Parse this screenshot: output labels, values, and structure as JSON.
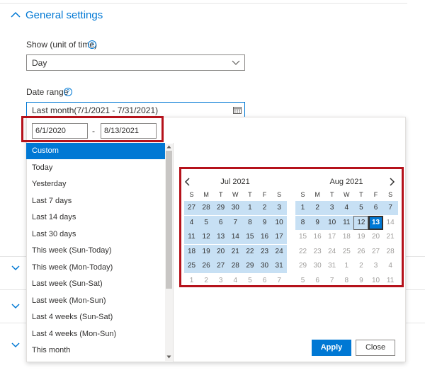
{
  "section": {
    "title": "General settings"
  },
  "show_field": {
    "label": "Show (unit of time)",
    "value": "Day"
  },
  "date_range": {
    "label": "Date range",
    "value": "Last month(7/1/2021 - 7/31/2021)",
    "start": "6/1/2020",
    "separator": "-",
    "end": "8/13/2021"
  },
  "help_glyph": "?",
  "presets": [
    "Custom",
    "Today",
    "Yesterday",
    "Last 7 days",
    "Last 14 days",
    "Last 30 days",
    "This week (Sun-Today)",
    "This week (Mon-Today)",
    "Last week (Sun-Sat)",
    "Last week (Mon-Sun)",
    "Last 4 weeks (Sun-Sat)",
    "Last 4 weeks (Mon-Sun)",
    "This month"
  ],
  "selected_preset": "Custom",
  "weekdays": [
    "S",
    "M",
    "T",
    "W",
    "T",
    "F",
    "S"
  ],
  "calendars": [
    {
      "title": "Jul 2021",
      "weeks": [
        [
          "27",
          "28",
          "29",
          "30",
          "1",
          "2",
          "3"
        ],
        [
          "4",
          "5",
          "6",
          "7",
          "8",
          "9",
          "10"
        ],
        [
          "11",
          "12",
          "13",
          "14",
          "15",
          "16",
          "17"
        ],
        [
          "18",
          "19",
          "20",
          "21",
          "22",
          "23",
          "24"
        ],
        [
          "25",
          "26",
          "27",
          "28",
          "29",
          "30",
          "31"
        ],
        [
          "1",
          "2",
          "3",
          "4",
          "5",
          "6",
          "7"
        ]
      ],
      "out_of_month": [
        "0-0",
        "0-1",
        "0-2",
        "0-3",
        "5-0",
        "5-1",
        "5-2",
        "5-3",
        "5-4",
        "5-5",
        "5-6"
      ],
      "in_range": [
        "0-0",
        "0-1",
        "0-2",
        "0-3",
        "0-4",
        "0-5",
        "0-6",
        "1-0",
        "1-1",
        "1-2",
        "1-3",
        "1-4",
        "1-5",
        "1-6",
        "2-0",
        "2-1",
        "2-2",
        "2-3",
        "2-4",
        "2-5",
        "2-6",
        "3-0",
        "3-1",
        "3-2",
        "3-3",
        "3-4",
        "3-5",
        "3-6",
        "4-0",
        "4-1",
        "4-2",
        "4-3",
        "4-4",
        "4-5",
        "4-6"
      ],
      "today": [],
      "selected": []
    },
    {
      "title": "Aug 2021",
      "weeks": [
        [
          "1",
          "2",
          "3",
          "4",
          "5",
          "6",
          "7"
        ],
        [
          "8",
          "9",
          "10",
          "11",
          "12",
          "13",
          "14"
        ],
        [
          "15",
          "16",
          "17",
          "18",
          "19",
          "20",
          "21"
        ],
        [
          "22",
          "23",
          "24",
          "25",
          "26",
          "27",
          "28"
        ],
        [
          "29",
          "30",
          "31",
          "1",
          "2",
          "3",
          "4"
        ],
        [
          "5",
          "6",
          "7",
          "8",
          "9",
          "10",
          "11"
        ]
      ],
      "out_of_month": [
        "4-3",
        "4-4",
        "4-5",
        "4-6",
        "5-0",
        "5-1",
        "5-2",
        "5-3",
        "5-4",
        "5-5",
        "5-6",
        "1-6",
        "2-0",
        "2-1",
        "2-2",
        "2-3",
        "2-4",
        "2-5",
        "2-6",
        "3-0",
        "3-1",
        "3-2",
        "3-3",
        "3-4",
        "3-5",
        "3-6",
        "4-0",
        "4-1",
        "4-2"
      ],
      "in_range": [
        "0-0",
        "0-1",
        "0-2",
        "0-3",
        "0-4",
        "0-5",
        "0-6",
        "1-0",
        "1-1",
        "1-2",
        "1-3",
        "1-4",
        "1-5"
      ],
      "today": [
        "1-4"
      ],
      "selected": [
        "1-5"
      ]
    }
  ],
  "buttons": {
    "apply": "Apply",
    "close": "Close"
  },
  "colors": {
    "accent": "#0078d4",
    "range": "#c7e0f4",
    "highlight_box": "#b5121b"
  }
}
